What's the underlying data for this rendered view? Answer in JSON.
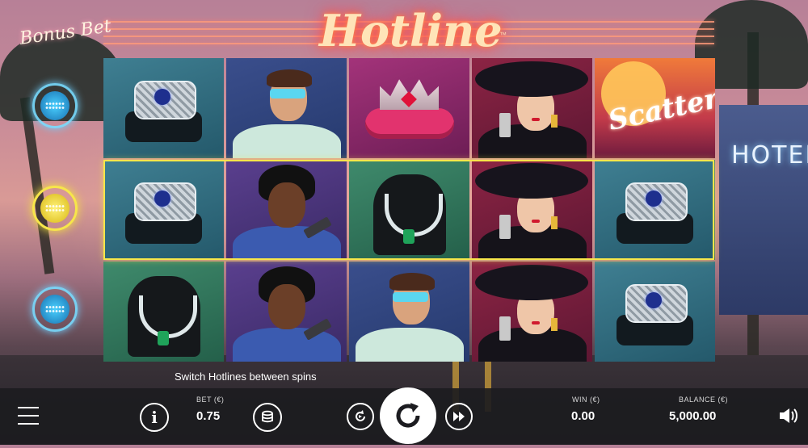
{
  "game": {
    "title": "Hotline",
    "trademark": "™",
    "bonus_bet_label": "Bonus Bet"
  },
  "bonus_indicators": [
    {
      "state": "inactive",
      "color": "#4ad0ff"
    },
    {
      "state": "active",
      "color": "#f7e64a"
    },
    {
      "state": "inactive",
      "color": "#4ad0ff"
    }
  ],
  "reels": {
    "rows": [
      [
        "ring",
        "man-sunglasses",
        "crown",
        "woman-hat",
        "scatter"
      ],
      [
        "ring",
        "man-gun",
        "necklace",
        "woman-hat",
        "ring"
      ],
      [
        "necklace",
        "man-gun",
        "man-sunglasses",
        "woman-hat",
        "ring"
      ]
    ],
    "scatter_label": "Scatter",
    "highlighted_row": 2
  },
  "hotel_sign": "HOTEL",
  "message": "Switch Hotlines between spins",
  "controls": {
    "menu_icon": "hamburger-icon",
    "info_icon": "info-icon",
    "bet_label": "BET (€)",
    "bet_value": "0.75",
    "coins_icon": "coin-stack-icon",
    "autoplay_icon": "autoplay-icon",
    "spin_icon": "spin-icon",
    "turbo_icon": "fast-forward-icon",
    "win_label": "WIN (€)",
    "win_value": "0.00",
    "balance_label": "BALANCE (€)",
    "balance_value": "5,000.00",
    "sound_icon": "speaker-icon"
  }
}
